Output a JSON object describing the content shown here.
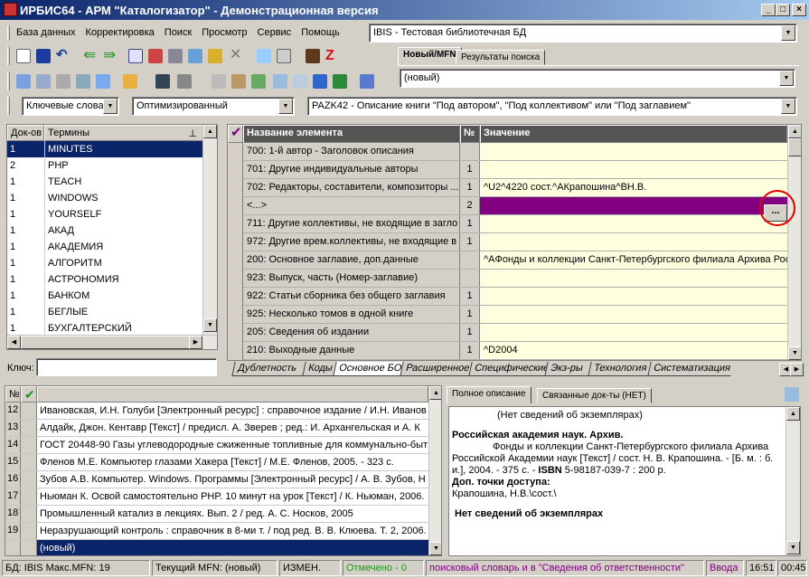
{
  "window": {
    "title": "ИРБИС64 - АРМ \"Каталогизатор\" - Демонстрационная версия"
  },
  "menu": [
    "База данных",
    "Корректировка",
    "Поиск",
    "Просмотр",
    "Сервис",
    "Помощь"
  ],
  "db_select": "IBIS - Тестовая библиотечная БД",
  "top_tabs": {
    "new": "Новый/MFN",
    "results": "Результаты поиска"
  },
  "new_select": "(новый)",
  "search_mode": "Ключевые слова",
  "optimized": "Оптимизированный",
  "worksheet": "PAZK42 - Описание книги \"Под автором\", \"Под коллективом\" или \"Под заглавием\"",
  "dict": {
    "col_docs": "Док-ов",
    "col_terms": "Термины",
    "key_label": "Ключ:",
    "rows": [
      [
        "1",
        "MINUTES"
      ],
      [
        "2",
        "PHP"
      ],
      [
        "1",
        "TEACH"
      ],
      [
        "1",
        "WINDOWS"
      ],
      [
        "1",
        "YOURSELF"
      ],
      [
        "1",
        "АКАД"
      ],
      [
        "1",
        "АКАДЕМИЯ"
      ],
      [
        "1",
        "АЛГОРИТМ"
      ],
      [
        "1",
        "АСТРОНОМИЯ"
      ],
      [
        "1",
        "БАНКОМ"
      ],
      [
        "1",
        "БЕГЛЫЕ"
      ],
      [
        "1",
        "БУХГАЛТЕРСКИЙ"
      ]
    ]
  },
  "editor": {
    "col_name": "Название элемента",
    "col_num": "№",
    "col_value": "Значение",
    "ellipsis": "...",
    "rows": [
      [
        "700: 1-й автор - Заголовок описания",
        "",
        ""
      ],
      [
        "701: Другие индивидуальные авторы",
        "1",
        ""
      ],
      [
        "702: Редакторы, составители, композиторы ...",
        "1",
        "^U2^4220 сост.^AКрапошина^BН.В."
      ],
      [
        "<...>",
        "2",
        ""
      ],
      [
        "711: Другие коллективы, не входящие в загло",
        "1",
        ""
      ],
      [
        "972: Другие врем.коллективы, не входящие в",
        "1",
        ""
      ],
      [
        "200: Основное заглавие, доп.данные",
        "",
        "^AФонды и коллекции Санкт-Петербургского филиала Архива Рос"
      ],
      [
        "923: Выпуск, часть (Номер-заглавие)",
        "",
        ""
      ],
      [
        "922: Статьи сборника без общего заглавия",
        "1",
        ""
      ],
      [
        "925: Несколько томов в одной книге",
        "1",
        ""
      ],
      [
        "205: Сведения об издании",
        "1",
        ""
      ],
      [
        "210: Выходные данные",
        "1",
        "^D2004"
      ]
    ]
  },
  "bottom_tabs": [
    "Дублетность",
    "Коды",
    "Основное БО",
    "Расширенное",
    "Специфические",
    "Экз-ры",
    "Технология",
    "Систематизация"
  ],
  "records": {
    "col_num": "№",
    "rows": [
      [
        "12",
        "Ивановская, И.Н. Голуби [Электронный ресурс] : справочное издание / И.Н. Иванов"
      ],
      [
        "13",
        "Алдайк, Джон. Кентавр [Текст] / предисл. А. Зверев ; ред.: И. Архангельская и А. К"
      ],
      [
        "14",
        "ГОСТ 20448-90 Газы углеводородные сжиженные топливные для коммунально-быт"
      ],
      [
        "15",
        "Фленов М.Е. Компьютер глазами Хакера [Текст] / М.Е. Фленов, 2005. - 323 с."
      ],
      [
        "16",
        "Зубов А.В. Компьютер. Windows. Программы [Электронный ресурс] / А. В. Зубов, Н"
      ],
      [
        "17",
        "Ньюман К. Освой самостоятельно PHP. 10 минут на урок [Текст] / К. Ньюман, 2006."
      ],
      [
        "18",
        "Промышленный катализ в лекциях. Вып. 2 / ред. А. С. Носков, 2005"
      ],
      [
        "19",
        "Неразрушающий контроль : справочник в 8-ми т. / под ред. В. В. Клюева. Т. 2, 2006."
      ],
      [
        "",
        "(новый)"
      ]
    ]
  },
  "desc_tabs": {
    "full": "Полное описание",
    "linked": "Связанные док-ты (НЕТ)"
  },
  "desc": {
    "l1": "(Нет сведений об экземплярах)",
    "l2": "Российская академия наук. Архив.",
    "l3": "Фонды и коллекции Санкт-Петербургского филиала Архива",
    "l4": "Российской Академии наук [Текст] / сост. Н. В. Крапошина. - [Б. м. : б.",
    "l5a": "и.], 2004. - 375 с. - ",
    "l5b": "ISBN",
    "l5c": " 5-98187-039-7 : 200 р.",
    "l6": "Доп. точки доступа:",
    "l7": "Крапошина, Н.В.\\сост.\\",
    "l8": "Нет сведений об экземплярах"
  },
  "status": {
    "db": "БД: IBIS Макс.MFN: 19",
    "mfn": "Текущий MFN: (новый)",
    "changed": "ИЗМЕН.",
    "marked": "Отмечено - 0",
    "hint": "поисковый словарь и в \"Сведения об ответственности\"",
    "input": "Ввода",
    "time": "16:51",
    "time2": "00:45"
  },
  "colors": {
    "selection": "#0a246a",
    "editor_sel": "#800080",
    "value_bg": "#ffffe0",
    "annot": "#e00000"
  }
}
